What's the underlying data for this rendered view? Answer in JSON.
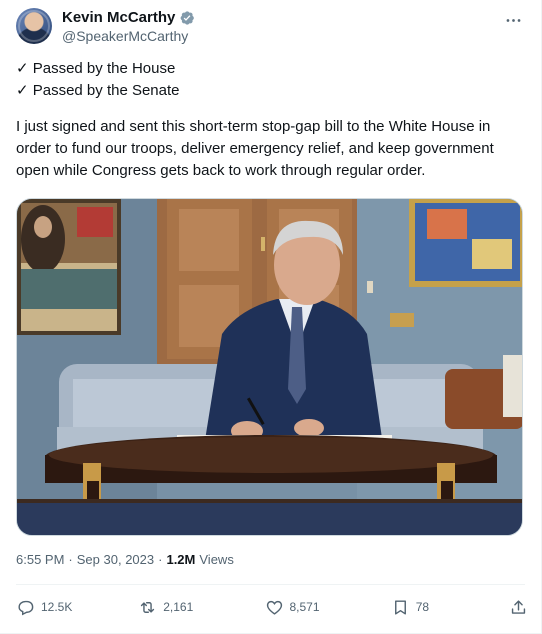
{
  "author": {
    "display_name": "Kevin McCarthy",
    "handle": "@SpeakerMcCarthy",
    "verified_color": "#829aab"
  },
  "tweet": {
    "line1": "✓ Passed by the House",
    "line2": "✓ Passed by the Senate",
    "body": "I just signed and sent this short-term stop-gap bill to the White House in order to fund our troops, deliver emergency relief, and keep government open while Congress gets back to work through regular order."
  },
  "meta": {
    "time": "6:55 PM",
    "separator": "·",
    "date": "Sep 30, 2023",
    "views_count": "1.2M",
    "views_label": "Views"
  },
  "actions": {
    "replies": "12.5K",
    "reposts": "2,161",
    "likes": "8,571",
    "bookmarks": "78"
  },
  "icons": {
    "more": "more-icon",
    "reply": "reply-icon",
    "repost": "repost-icon",
    "like": "heart-icon",
    "bookmark": "bookmark-icon",
    "share": "share-icon"
  },
  "colors": {
    "text_primary": "#0f1419",
    "text_secondary": "#536471",
    "border": "#eff3f4"
  }
}
